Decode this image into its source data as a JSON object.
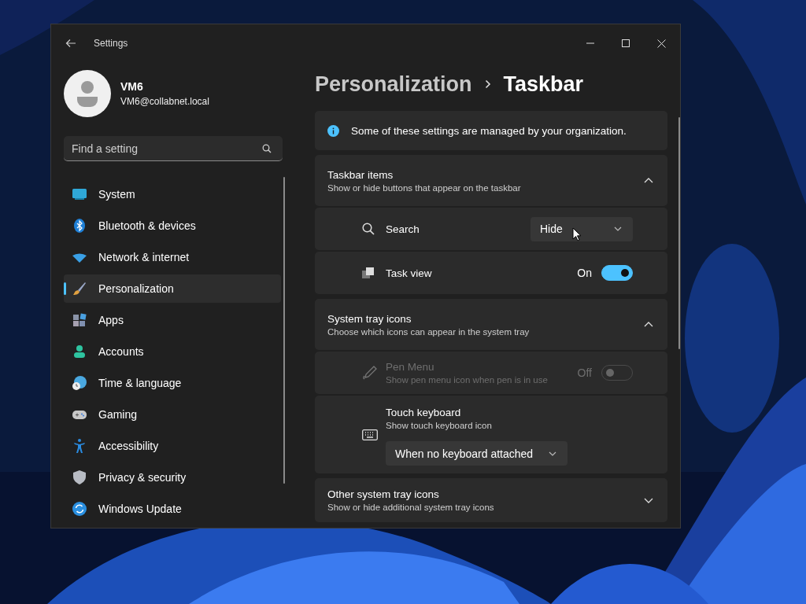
{
  "window": {
    "title": "Settings"
  },
  "user": {
    "name": "VM6",
    "email": "VM6@collabnet.local"
  },
  "search": {
    "placeholder": "Find a setting"
  },
  "nav": [
    {
      "label": "System",
      "selected": false
    },
    {
      "label": "Bluetooth & devices",
      "selected": false
    },
    {
      "label": "Network & internet",
      "selected": false
    },
    {
      "label": "Personalization",
      "selected": true
    },
    {
      "label": "Apps",
      "selected": false
    },
    {
      "label": "Accounts",
      "selected": false
    },
    {
      "label": "Time & language",
      "selected": false
    },
    {
      "label": "Gaming",
      "selected": false
    },
    {
      "label": "Accessibility",
      "selected": false
    },
    {
      "label": "Privacy & security",
      "selected": false
    },
    {
      "label": "Windows Update",
      "selected": false
    }
  ],
  "breadcrumb": [
    "Personalization",
    "Taskbar"
  ],
  "notice": "Some of these settings are managed by your organization.",
  "sections": [
    {
      "title": "Taskbar items",
      "subtitle": "Show or hide buttons that appear on the taskbar",
      "expanded": true,
      "items": [
        {
          "kind": "dropdown",
          "label": "Search",
          "value": "Hide",
          "disabled": false
        },
        {
          "kind": "toggle",
          "label": "Task view",
          "state_label": "On",
          "on": true,
          "disabled": false
        }
      ]
    },
    {
      "title": "System tray icons",
      "subtitle": "Choose which icons can appear in the system tray",
      "expanded": true,
      "items": [
        {
          "kind": "toggle",
          "label": "Pen Menu",
          "description": "Show pen menu icon when pen is in use",
          "state_label": "Off",
          "on": false,
          "disabled": true
        },
        {
          "kind": "dropdown-below",
          "label": "Touch keyboard",
          "description": "Show touch keyboard icon",
          "value": "When no keyboard attached",
          "disabled": false
        }
      ]
    },
    {
      "title": "Other system tray icons",
      "subtitle": "Show or hide additional system tray icons",
      "expanded": false
    }
  ]
}
